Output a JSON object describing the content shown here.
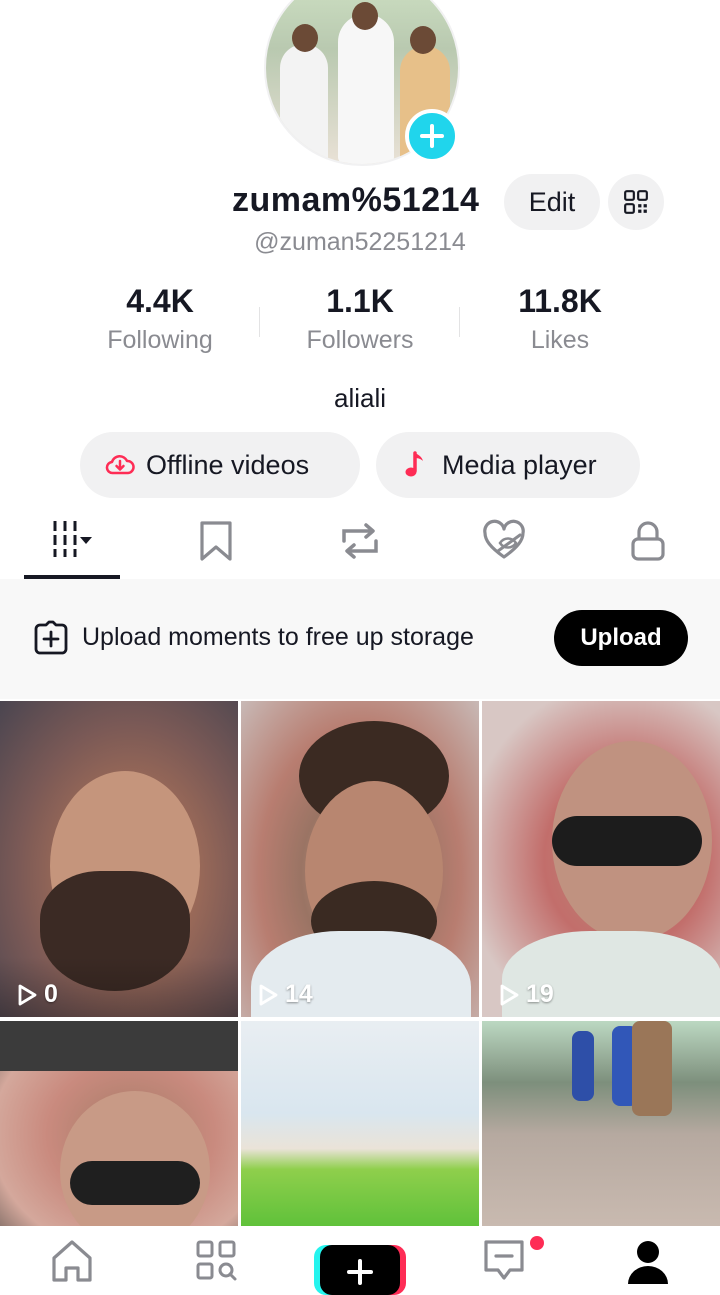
{
  "profile": {
    "username": "zumam%51214",
    "handle": "@zuman52251214",
    "bio": "aliali",
    "edit_label": "Edit"
  },
  "stats": [
    {
      "value": "4.4K",
      "label": "Following"
    },
    {
      "value": "1.1K",
      "label": "Followers"
    },
    {
      "value": "11.8K",
      "label": "Likes"
    }
  ],
  "actions": {
    "offline_label": "Offline videos",
    "media_label": "Media player"
  },
  "tabs": [
    {
      "icon": "grid-videos-icon",
      "active": true
    },
    {
      "icon": "bookmark-icon",
      "active": false
    },
    {
      "icon": "repost-icon",
      "active": false
    },
    {
      "icon": "liked-hidden-icon",
      "active": false
    },
    {
      "icon": "lock-icon",
      "active": false
    }
  ],
  "banner": {
    "text": "Upload moments to free up storage",
    "button_label": "Upload"
  },
  "videos": [
    {
      "views": "0"
    },
    {
      "views": "14"
    },
    {
      "views": "19"
    },
    {
      "views": ""
    },
    {
      "views": ""
    },
    {
      "views": ""
    }
  ],
  "bottom_nav": [
    {
      "icon": "home-icon"
    },
    {
      "icon": "discover-icon"
    },
    {
      "icon": "create-plus-icon"
    },
    {
      "icon": "inbox-icon",
      "badge": true
    },
    {
      "icon": "profile-icon"
    }
  ],
  "colors": {
    "accent_cyan": "#20d5ec",
    "accent_red": "#fe2c55",
    "text_primary": "#161823",
    "text_secondary": "#8a8b91"
  }
}
